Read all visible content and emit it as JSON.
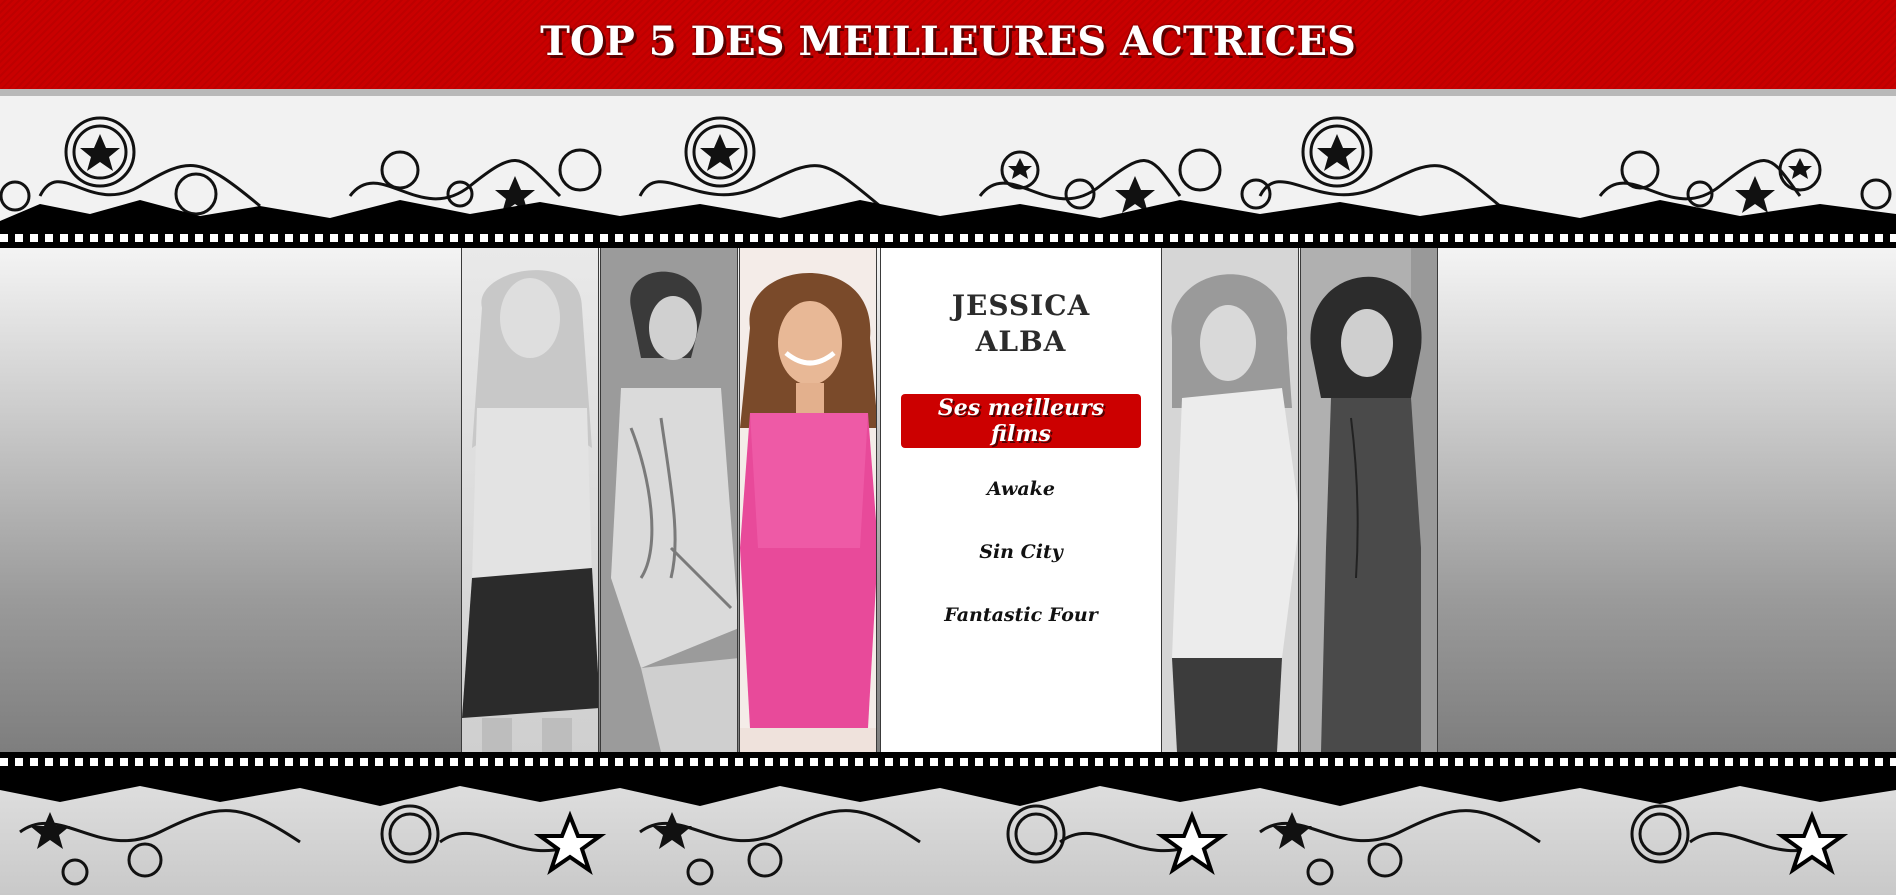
{
  "header": {
    "title": "TOP 5 DES MEILLEURES ACTRICES"
  },
  "colors": {
    "accent": "#cc0000",
    "header_bg": "#c90000"
  },
  "gallery": {
    "actresses": [
      {
        "panel": "actress-photo-1",
        "tone": "grayscale"
      },
      {
        "panel": "actress-photo-2",
        "tone": "grayscale"
      },
      {
        "panel": "actress-photo-3",
        "tone": "color"
      },
      {
        "panel": "actress-photo-4",
        "tone": "grayscale"
      },
      {
        "panel": "actress-photo-5",
        "tone": "grayscale"
      }
    ]
  },
  "selected": {
    "name_line1": "JESSICA",
    "name_line2": "ALBA",
    "films_button": "Ses meilleurs films",
    "films": [
      "Awake",
      "Sin City",
      "Fantastic Four"
    ]
  }
}
